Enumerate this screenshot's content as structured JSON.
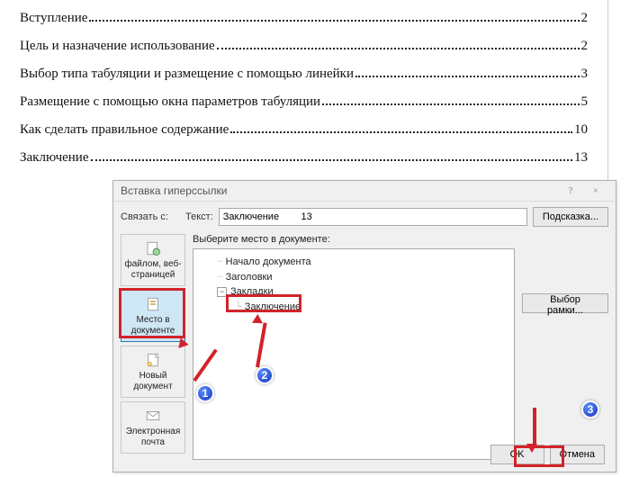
{
  "toc": [
    {
      "title": "Вступление",
      "page": "2"
    },
    {
      "title": "Цель и назначение использование",
      "page": "2"
    },
    {
      "title": "Выбор типа табуляции и размещение с помощью линейки",
      "page": "3"
    },
    {
      "title": "Размещение с помощью окна параметров табуляции",
      "page": "5"
    },
    {
      "title": "Как сделать правильное содержание",
      "page": "10"
    },
    {
      "title": "Заключение",
      "page": "13"
    }
  ],
  "dialog": {
    "title": "Вставка гиперссылки",
    "help": "?",
    "close": "×",
    "linkto_label": "Связать с:",
    "text_label": "Текст:",
    "text_value": "Заключение        13",
    "hint_button": "Подсказка...",
    "select_label": "Выберите место в документе:",
    "tree": {
      "n0": "Начало документа",
      "n1": "Заголовки",
      "n2": "Закладки",
      "n2_0": "Заключение"
    },
    "side": {
      "file": "файлом, веб-страницей",
      "place": "Место в документе",
      "newdoc": "Новый документ",
      "email": "Электронная почта"
    },
    "frame_button": "Выбор рамки...",
    "ok": "OK",
    "cancel": "Отмена"
  },
  "steps": {
    "s1": "1",
    "s2": "2",
    "s3": "3"
  }
}
